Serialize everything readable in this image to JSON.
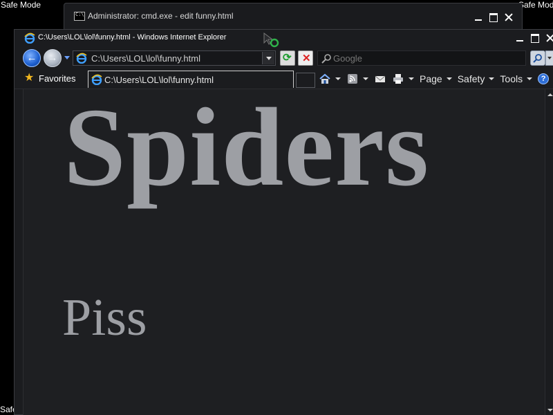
{
  "desktop": {
    "safe_mode_left": "Safe Mode",
    "safe_mode_right": "Safe Mode",
    "safe_mode_bottom": "Safe"
  },
  "cmd_window": {
    "title": "Administrator: cmd.exe - edit  funny.html",
    "icon_text": "C:\\"
  },
  "ie_window": {
    "title": "C:\\Users\\LOL\\lol\\funny.html - Windows Internet Explorer"
  },
  "navigation": {
    "back_glyph": "←",
    "forward_glyph": "→",
    "address": "C:\\Users\\LOL\\lol\\funny.html",
    "refresh_glyph": "⟳",
    "stop_glyph": "✕",
    "search_placeholder": "Google"
  },
  "favorites_bar": {
    "favorites_label": "Favorites",
    "tab_title": "C:\\Users\\LOL\\lol\\funny.html"
  },
  "command_bar": {
    "page_label": "Page",
    "safety_label": "Safety",
    "tools_label": "Tools",
    "help_glyph": "?"
  },
  "page": {
    "heading": "Spiders",
    "paragraph": "Piss"
  },
  "colors": {
    "background": "#000000",
    "page_background": "#1e1f22",
    "page_text": "#9d9fa4",
    "favorites_star": "#f2b71f"
  }
}
